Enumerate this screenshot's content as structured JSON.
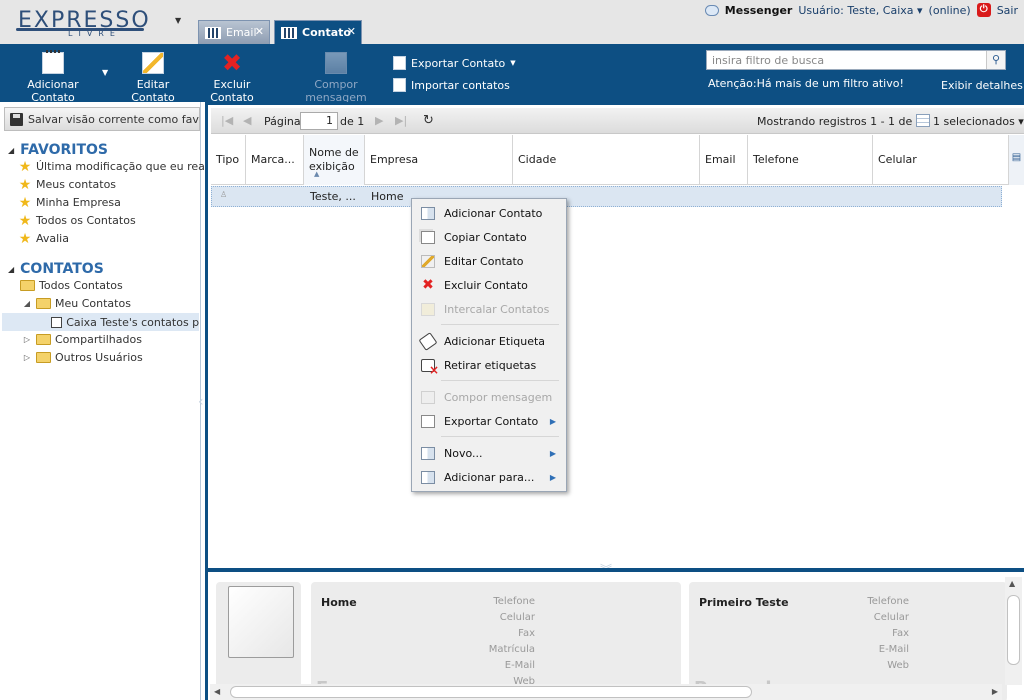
{
  "app": {
    "logo_top": "EXPRESSO",
    "logo_bottom": "LIVRE"
  },
  "tabs": [
    {
      "label": "Email",
      "active": false
    },
    {
      "label": "Contato",
      "active": true
    }
  ],
  "userbar": {
    "messenger": "Messenger",
    "user": "Usuário: Teste, Caixa",
    "status": "(online)",
    "logout": "Sair"
  },
  "toolbar": {
    "add_contact": "Adicionar Contato",
    "edit_contact": "Editar Contato",
    "delete_contact": "Excluir Contato",
    "compose_message": "Compor mensagem",
    "export_contact": "Exportar Contato",
    "import_contacts": "Importar contatos",
    "search_placeholder": "insira filtro de busca",
    "filter_warning": "Atenção:Há mais de um filtro ativo!",
    "show_details": "Exibir detalhes"
  },
  "sidebar": {
    "save_view": "Salvar visão corrente como favorito",
    "favorites_title": "FAVORITOS",
    "favorites": [
      "Última modificação que eu realizei",
      "Meus contatos",
      "Minha Empresa",
      "Todos os Contatos",
      "Avalia"
    ],
    "contacts_title": "CONTATOS",
    "tree": {
      "all": "Todos Contatos",
      "mine": "Meu Contatos",
      "personal": "Caixa Teste's contatos pessoais",
      "shared": "Compartilhados",
      "others": "Outros Usuários"
    }
  },
  "grid": {
    "page_label": "Página",
    "page_value": "1",
    "page_of": "de 1",
    "records_info": "Mostrando registros 1 - 1 de 1",
    "selected_info": "1 selecionados",
    "columns": [
      "Tipo",
      "Marca...",
      "Nome de exibição",
      "Empresa",
      "Cidade",
      "Email",
      "Telefone",
      "Celular"
    ],
    "rows": [
      {
        "tipo": "",
        "marca": "",
        "nome": "Teste, ...",
        "empresa": "Home",
        "cidade": "",
        "email": "",
        "telefone": "",
        "celular": ""
      }
    ]
  },
  "context_menu": {
    "items": [
      {
        "label": "Adicionar Contato",
        "enabled": true,
        "submenu": false
      },
      {
        "label": "Copiar Contato",
        "enabled": true,
        "submenu": false
      },
      {
        "label": "Editar Contato",
        "enabled": true,
        "submenu": false
      },
      {
        "label": "Excluir Contato",
        "enabled": true,
        "submenu": false
      },
      {
        "label": "Intercalar Contatos",
        "enabled": false,
        "submenu": false
      },
      {
        "label": "Adicionar Etiqueta",
        "enabled": true,
        "submenu": false
      },
      {
        "label": "Retirar etiquetas",
        "enabled": true,
        "submenu": false
      },
      {
        "label": "Compor mensagem",
        "enabled": false,
        "submenu": false
      },
      {
        "label": "Exportar Contato",
        "enabled": true,
        "submenu": true
      },
      {
        "label": "Novo...",
        "enabled": true,
        "submenu": true
      },
      {
        "label": "Adicionar para...",
        "enabled": true,
        "submenu": true
      }
    ]
  },
  "details": {
    "company_card": {
      "title": "Home",
      "fields": [
        "Telefone",
        "Celular",
        "Fax",
        "Matrícula",
        "E-Mail",
        "Web"
      ],
      "watermark": "Empresa"
    },
    "personal_card": {
      "title": "Primeiro Teste",
      "fields": [
        "Telefone",
        "Celular",
        "Fax",
        "E-Mail",
        "Web"
      ],
      "watermark": "Pessoal"
    }
  },
  "colors": {
    "brand_blue": "#0d4f83",
    "section_blue": "#2e6aa9",
    "selected_row": "#dbe6f2",
    "delete_red": "#e32222"
  }
}
